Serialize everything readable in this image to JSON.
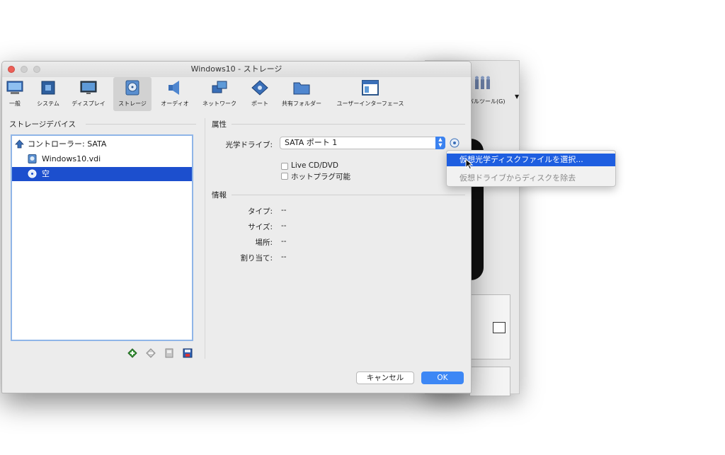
{
  "window": {
    "title": "Windows10 - ストレージ"
  },
  "toolbar": {
    "items": [
      {
        "label": "一般"
      },
      {
        "label": "システム"
      },
      {
        "label": "ディスプレイ"
      },
      {
        "label": "ストレージ"
      },
      {
        "label": "オーディオ"
      },
      {
        "label": "ネットワーク"
      },
      {
        "label": "ポート"
      },
      {
        "label": "共有フォルダー"
      },
      {
        "label": "ユーザーインターフェース"
      }
    ],
    "active_index": 3
  },
  "storage": {
    "section_title": "ストレージデバイス",
    "tree": [
      {
        "label": "コントローラー: SATA",
        "icon": "controller-icon"
      },
      {
        "label": "Windows10.vdi",
        "icon": "hard-disk-icon"
      },
      {
        "label": "空",
        "icon": "optical-disc-icon"
      }
    ],
    "selected_index": 2
  },
  "attributes": {
    "section_title": "属性",
    "drive_label": "光学ドライブ:",
    "drive_value": "SATA ポート 1",
    "live_cd_label": "Live CD/DVD",
    "hotplug_label": "ホットプラグ可能"
  },
  "info": {
    "section_title": "情報",
    "rows": [
      {
        "label": "タイプ:",
        "value": "--"
      },
      {
        "label": "サイズ:",
        "value": "--"
      },
      {
        "label": "場所:",
        "value": "--"
      },
      {
        "label": "割り当て:",
        "value": "--"
      }
    ]
  },
  "buttons": {
    "cancel": "キャンセル",
    "ok": "OK"
  },
  "popup": {
    "items": [
      {
        "label": "仮想光学ディスクファイルを選択..."
      },
      {
        "label": "仮想ドライブからディスクを除去"
      }
    ]
  },
  "background_window": {
    "tools_label": "バルツール(G)"
  },
  "colors": {
    "accent": "#3d87f5",
    "selection": "#1c4fce",
    "menu_highlight": "#1e5ee0"
  }
}
